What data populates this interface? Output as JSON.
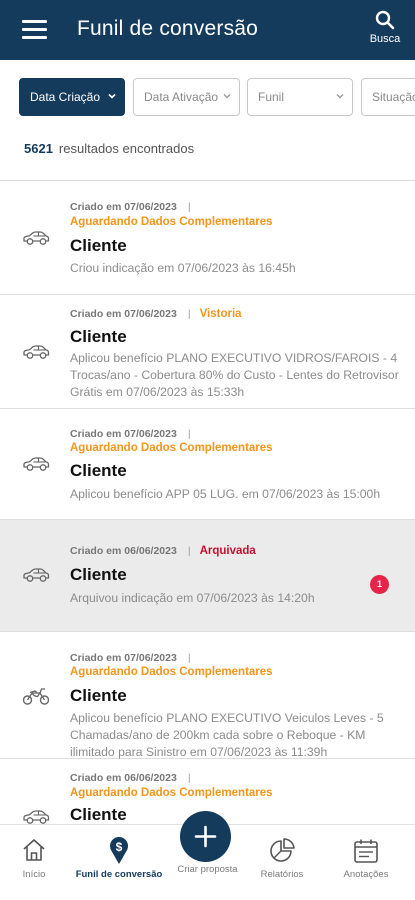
{
  "header": {
    "title": "Funil de conversão",
    "search_label": "Busca"
  },
  "filters": [
    {
      "label": "Data Criação",
      "active": true
    },
    {
      "label": "Data Ativação",
      "active": false
    },
    {
      "label": "Funil",
      "active": false
    },
    {
      "label": "Situação",
      "active": false
    }
  ],
  "results": {
    "count": "5621",
    "label": "resultados encontrados"
  },
  "items": [
    {
      "created": "Criado em 07/06/2023",
      "separator": "|",
      "status": "Aguardando Dados Complementares",
      "status_color": "#f2951b",
      "name": "Cliente",
      "description": "Criou indicação em 07/06/2023 às 16:45h",
      "vehicle_icon": "car-icon"
    },
    {
      "created": "Criado em 07/06/2023",
      "separator": "|",
      "status": "Vistoria",
      "status_color": "#f2951b",
      "name": "Cliente",
      "description": "Aplicou benefício PLANO EXECUTIVO VIDROS/FAROIS - 4 Trocas/ano - Cobertura 80% do Custo - Lentes do Retrovisor Grátis em 07/06/2023 às 15:33h",
      "vehicle_icon": "car-icon"
    },
    {
      "created": "Criado em 07/06/2023",
      "separator": "|",
      "status": "Aguardando Dados Complementares",
      "status_color": "#f2951b",
      "name": "Cliente",
      "description": "Aplicou benefício APP 05 LUG. em 07/06/2023 às 15:00h",
      "vehicle_icon": "car-icon"
    },
    {
      "created": "Criado em 06/06/2023",
      "separator": "|",
      "status": "Arquivada",
      "status_color": "#c8102e",
      "name": "Cliente",
      "description": "Arquivou indicação em 07/06/2023 às 14:20h",
      "vehicle_icon": "car-icon",
      "badge": "1"
    },
    {
      "created": "Criado em 07/06/2023",
      "separator": "|",
      "status": "Aguardando Dados Complementares",
      "status_color": "#f2951b",
      "name": "Cliente",
      "description": "Aplicou benefício PLANO EXECUTIVO Veiculos Leves - 5 Chamadas/ano de 200km cada sobre o Reboque - KM ilimitado para Sinistro em 07/06/2023 às 11:39h",
      "vehicle_icon": "motorcycle-icon"
    },
    {
      "created": "Criado em 06/06/2023",
      "separator": "|",
      "status": "Aguardando Dados Complementares",
      "status_color": "#f2951b",
      "name": "Cliente",
      "description": "",
      "vehicle_icon": "car-icon"
    }
  ],
  "bottom_nav": [
    {
      "label": "Início",
      "icon": "home-icon",
      "active": false
    },
    {
      "label": "Funil de conversão",
      "icon": "funnel-location-icon",
      "active": true
    },
    {
      "label": "Criar proposta",
      "icon": "plus-icon",
      "active": false
    },
    {
      "label": "Relatórios",
      "icon": "pie-chart-icon",
      "active": false
    },
    {
      "label": "Anotações",
      "icon": "notes-icon",
      "active": false
    }
  ],
  "colors": {
    "primary": "#143a5c",
    "orange": "#f2951b",
    "red": "#c8102e",
    "badge": "#e8244a"
  }
}
